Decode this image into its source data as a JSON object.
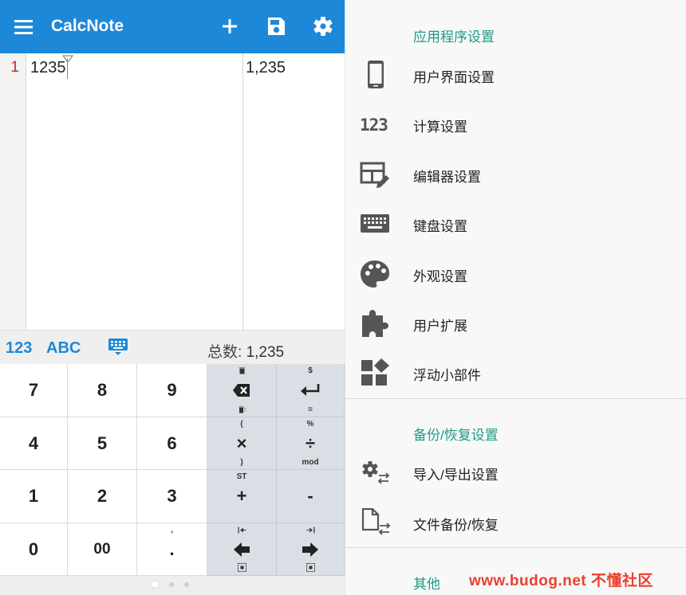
{
  "app": {
    "title": "CalcNote"
  },
  "editor": {
    "line_number": "1",
    "expression": "1235",
    "result": "1,235"
  },
  "keyboard_bar": {
    "mode_numeric": "123",
    "mode_alpha": "ABC",
    "total_label": "总数:",
    "total_value": "1,235"
  },
  "keypad": {
    "k7": "7",
    "k8": "8",
    "k9": "9",
    "k4": "4",
    "k5": "5",
    "k6": "6",
    "k1": "1",
    "k2": "2",
    "k3": "3",
    "k0": "0",
    "k00": "00",
    "kdot": ".",
    "kdot_sub": ",",
    "enter_top": "$",
    "enter_bot": "=",
    "mul": "×",
    "mul_top": "(",
    "mul_bot": ")",
    "div": "÷",
    "div_top": "%",
    "div_bot": "mod",
    "plus": "+",
    "plus_top": "ST",
    "minus": "-"
  },
  "settings": {
    "section_app": "应用程序设置",
    "items_app": [
      {
        "label": "用户界面设置",
        "icon": "phone-icon"
      },
      {
        "label": "计算设置",
        "icon": "numbers-icon"
      },
      {
        "label": "编辑器设置",
        "icon": "table-edit-icon"
      },
      {
        "label": "键盘设置",
        "icon": "keyboard-icon"
      },
      {
        "label": "外观设置",
        "icon": "palette-icon"
      },
      {
        "label": "用户扩展",
        "icon": "puzzle-icon"
      },
      {
        "label": "浮动小部件",
        "icon": "widgets-icon"
      }
    ],
    "section_backup": "备份/恢复设置",
    "items_backup": [
      {
        "label": "导入/导出设置",
        "icon": "settings-transfer-icon"
      },
      {
        "label": "文件备份/恢复",
        "icon": "file-transfer-icon"
      }
    ],
    "section_other": "其他"
  },
  "watermark": "www.budog.net 不懂社区",
  "colors": {
    "appbar": "#1e88d8",
    "section_header": "#1e9a86",
    "line_number": "#c62828",
    "watermark": "#e8412f"
  }
}
